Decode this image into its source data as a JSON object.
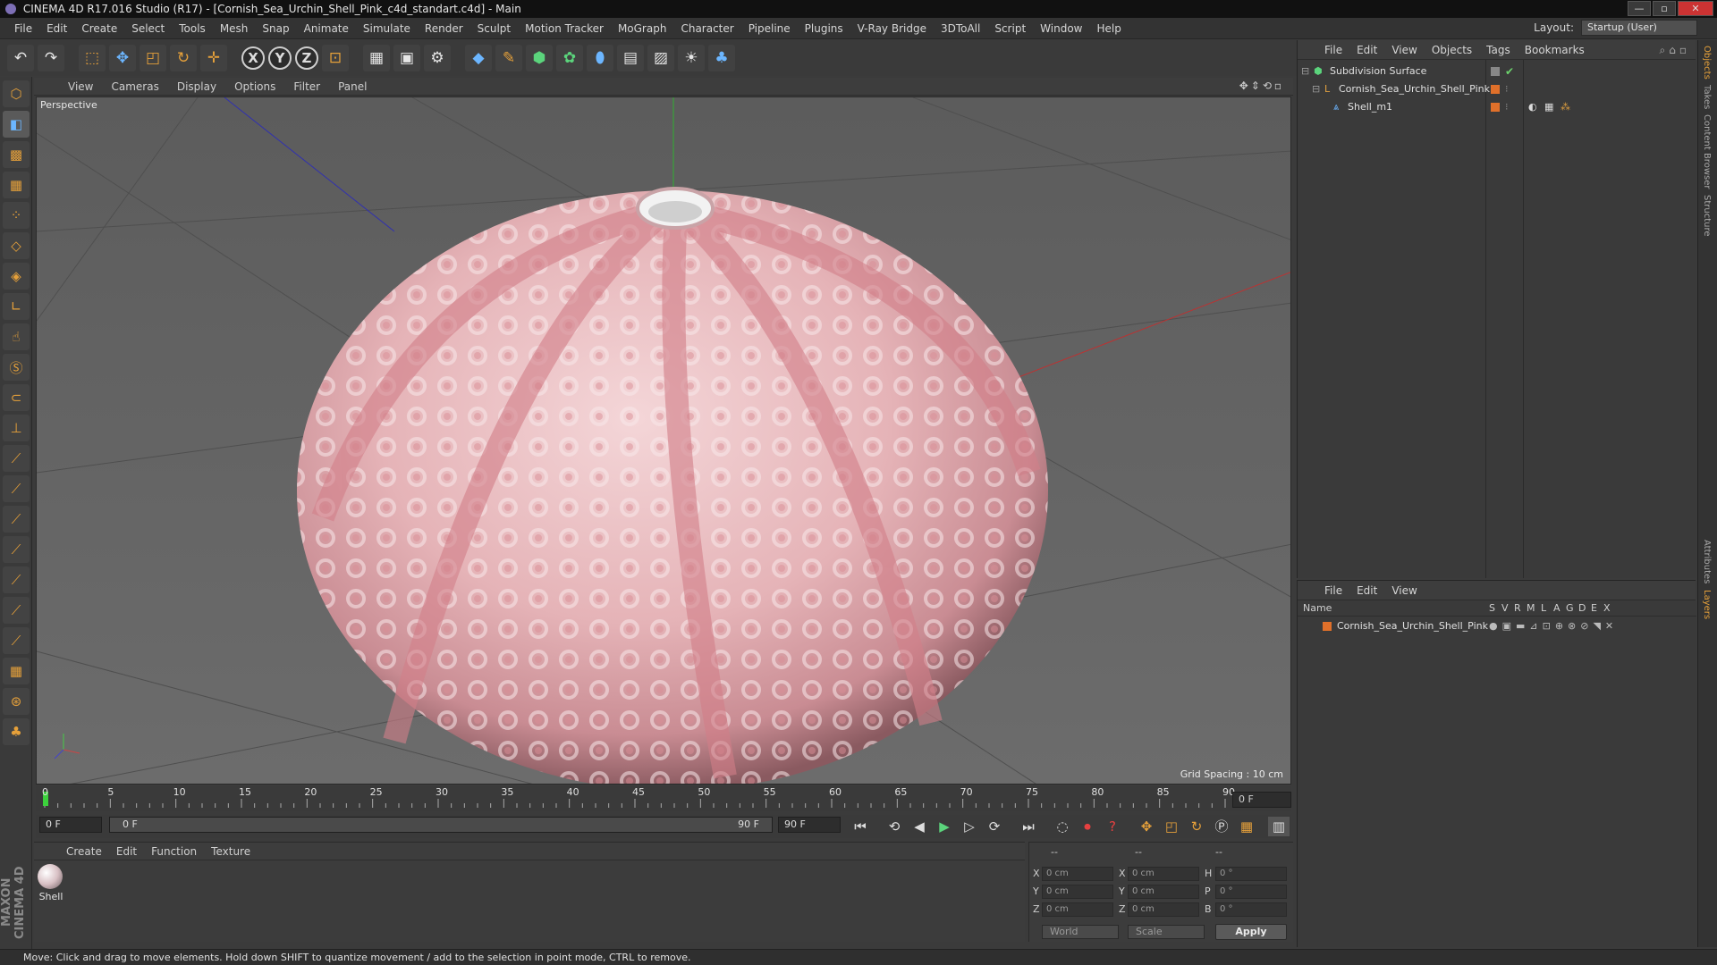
{
  "window": {
    "title": "CINEMA 4D R17.016 Studio (R17) - [Cornish_Sea_Urchin_Shell_Pink_c4d_standart.c4d] - Main",
    "minimize": "—",
    "maximize": "▫",
    "close": "✕"
  },
  "menu": [
    "File",
    "Edit",
    "Create",
    "Select",
    "Tools",
    "Mesh",
    "Snap",
    "Animate",
    "Simulate",
    "Render",
    "Sculpt",
    "Motion Tracker",
    "MoGraph",
    "Character",
    "Pipeline",
    "Plugins",
    "V-Ray Bridge",
    "3DToAll",
    "Script",
    "Window",
    "Help"
  ],
  "layout": {
    "label": "Layout:",
    "value": "Startup (User)"
  },
  "toolbar": {
    "axis_x": "X",
    "axis_y": "Y",
    "axis_z": "Z"
  },
  "viewport": {
    "menu": [
      "View",
      "Cameras",
      "Display",
      "Options",
      "Filter",
      "Panel"
    ],
    "label": "Perspective",
    "grid_spacing": "Grid Spacing : 10 cm"
  },
  "timeline": {
    "ticks": [
      "0",
      "5",
      "10",
      "15",
      "20",
      "25",
      "30",
      "35",
      "40",
      "45",
      "50",
      "55",
      "60",
      "65",
      "70",
      "75",
      "80",
      "85",
      "90"
    ],
    "current_frame_right": "0 F",
    "start_field": "0 F",
    "range_start": "0 F",
    "range_end": "90 F",
    "end_field": "90 F"
  },
  "material_manager": {
    "menu": [
      "Create",
      "Edit",
      "Function",
      "Texture"
    ],
    "material_name": "Shell"
  },
  "coordinates": {
    "header": [
      "--",
      "--",
      "--"
    ],
    "rows": [
      {
        "axis": "X",
        "pos": "0 cm",
        "axis2": "X",
        "size": "0 cm",
        "rot_label": "H",
        "rot": "0 °"
      },
      {
        "axis": "Y",
        "pos": "0 cm",
        "axis2": "Y",
        "size": "0 cm",
        "rot_label": "P",
        "rot": "0 °"
      },
      {
        "axis": "Z",
        "pos": "0 cm",
        "axis2": "Z",
        "size": "0 cm",
        "rot_label": "B",
        "rot": "0 °"
      }
    ],
    "world": "World",
    "scale": "Scale",
    "apply": "Apply"
  },
  "object_manager": {
    "menu": [
      "File",
      "Edit",
      "View",
      "Objects",
      "Tags",
      "Bookmarks"
    ],
    "objects": [
      {
        "name": "Subdivision Surface"
      },
      {
        "name": "Cornish_Sea_Urchin_Shell_Pink"
      },
      {
        "name": "Shell_m1"
      }
    ]
  },
  "layer_manager": {
    "menu": [
      "File",
      "Edit",
      "View"
    ],
    "columns": [
      "Name",
      "S",
      "V",
      "R",
      "M",
      "L",
      "A",
      "G",
      "D",
      "E",
      "X"
    ],
    "layers": [
      {
        "name": "Cornish_Sea_Urchin_Shell_Pink"
      }
    ]
  },
  "side_tabs": [
    "Objects",
    "Takes",
    "Content Browser",
    "Structure",
    "Attributes",
    "Layers"
  ],
  "status": "Move: Click and drag to move elements. Hold down SHIFT to quantize movement / add to the selection in point mode, CTRL to remove.",
  "brand": "MAXON CINEMA 4D"
}
